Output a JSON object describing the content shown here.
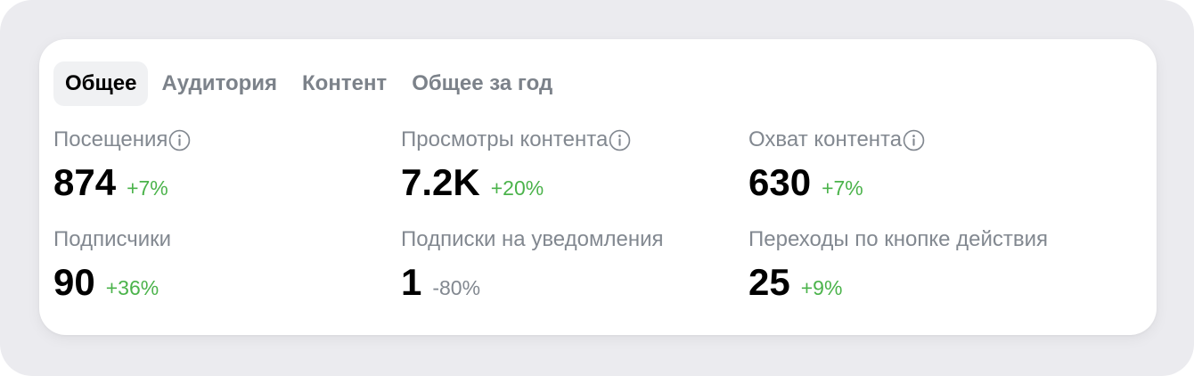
{
  "tabs": [
    {
      "label": "Общее",
      "active": true
    },
    {
      "label": "Аудитория",
      "active": false
    },
    {
      "label": "Контент",
      "active": false
    },
    {
      "label": "Общее за год",
      "active": false
    }
  ],
  "metrics": [
    {
      "label": "Посещения",
      "value": "874",
      "delta": "+7%",
      "info": true,
      "trend": "positive"
    },
    {
      "label": "Просмотры контента",
      "value": "7.2K",
      "delta": "+20%",
      "info": true,
      "trend": "positive"
    },
    {
      "label": "Охват контента",
      "value": "630",
      "delta": "+7%",
      "info": true,
      "trend": "positive"
    },
    {
      "label": "Подписчики",
      "value": "90",
      "delta": "+36%",
      "info": false,
      "trend": "positive"
    },
    {
      "label": "Подписки на уведомления",
      "value": "1",
      "delta": "-80%",
      "info": false,
      "trend": "negative"
    },
    {
      "label": "Переходы по кнопке действия",
      "value": "25",
      "delta": "+9%",
      "info": false,
      "trend": "positive"
    }
  ],
  "colors": {
    "positive": "#4bb34b",
    "negative": "#828890",
    "label": "#828890",
    "value": "#000000"
  },
  "icons": {
    "info": "info-circle-icon"
  }
}
